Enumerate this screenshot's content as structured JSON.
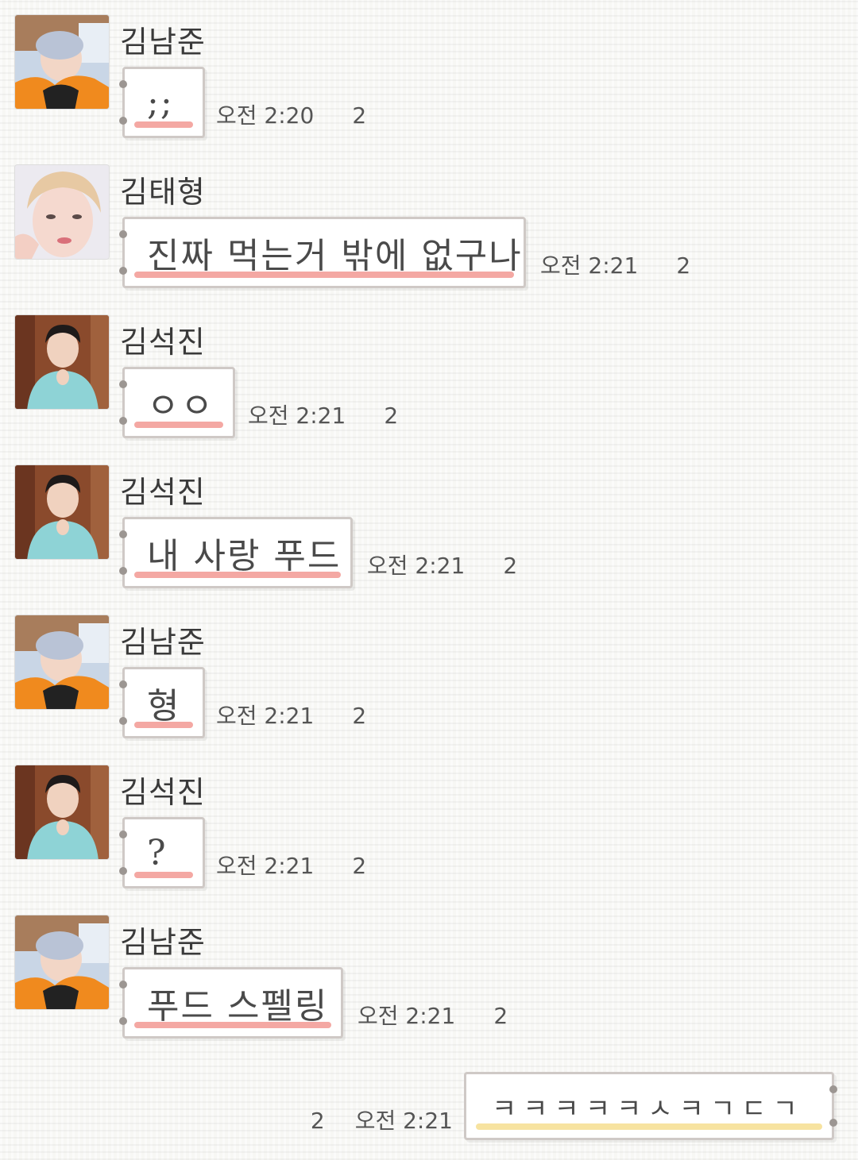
{
  "messages": [
    {
      "sender": "김남준",
      "avatar": "namjoon-avatar",
      "text": ";;",
      "time": "오전 2:20",
      "read": "2"
    },
    {
      "sender": "김태형",
      "avatar": "taehyung-avatar",
      "text": "진짜 먹는거 밖에 없구나",
      "time": "오전 2:21",
      "read": "2"
    },
    {
      "sender": "김석진",
      "avatar": "seokjin-avatar",
      "text": "ㅇㅇ",
      "time": "오전 2:21",
      "read": "2"
    },
    {
      "sender": "김석진",
      "avatar": "seokjin-avatar",
      "text": "내 사랑 푸드",
      "time": "오전 2:21",
      "read": "2"
    },
    {
      "sender": "김남준",
      "avatar": "namjoon-avatar",
      "text": "형",
      "time": "오전 2:21",
      "read": "2"
    },
    {
      "sender": "김석진",
      "avatar": "seokjin-avatar",
      "text": "?",
      "time": "오전 2:21",
      "read": "2"
    },
    {
      "sender": "김남준",
      "avatar": "namjoon-avatar",
      "text": "푸드 스펠링",
      "time": "오전 2:21",
      "read": "2"
    }
  ],
  "my_message": {
    "text": "ㅋㅋㅋㅋㅋㅅㅋㄱㄷㄱ",
    "time": "오전 2:21",
    "read": "2"
  },
  "colors": {
    "received_underline": "#f4a8a3",
    "sent_underline": "#f7e3a0",
    "bubble_border": "#cfc9c6"
  }
}
